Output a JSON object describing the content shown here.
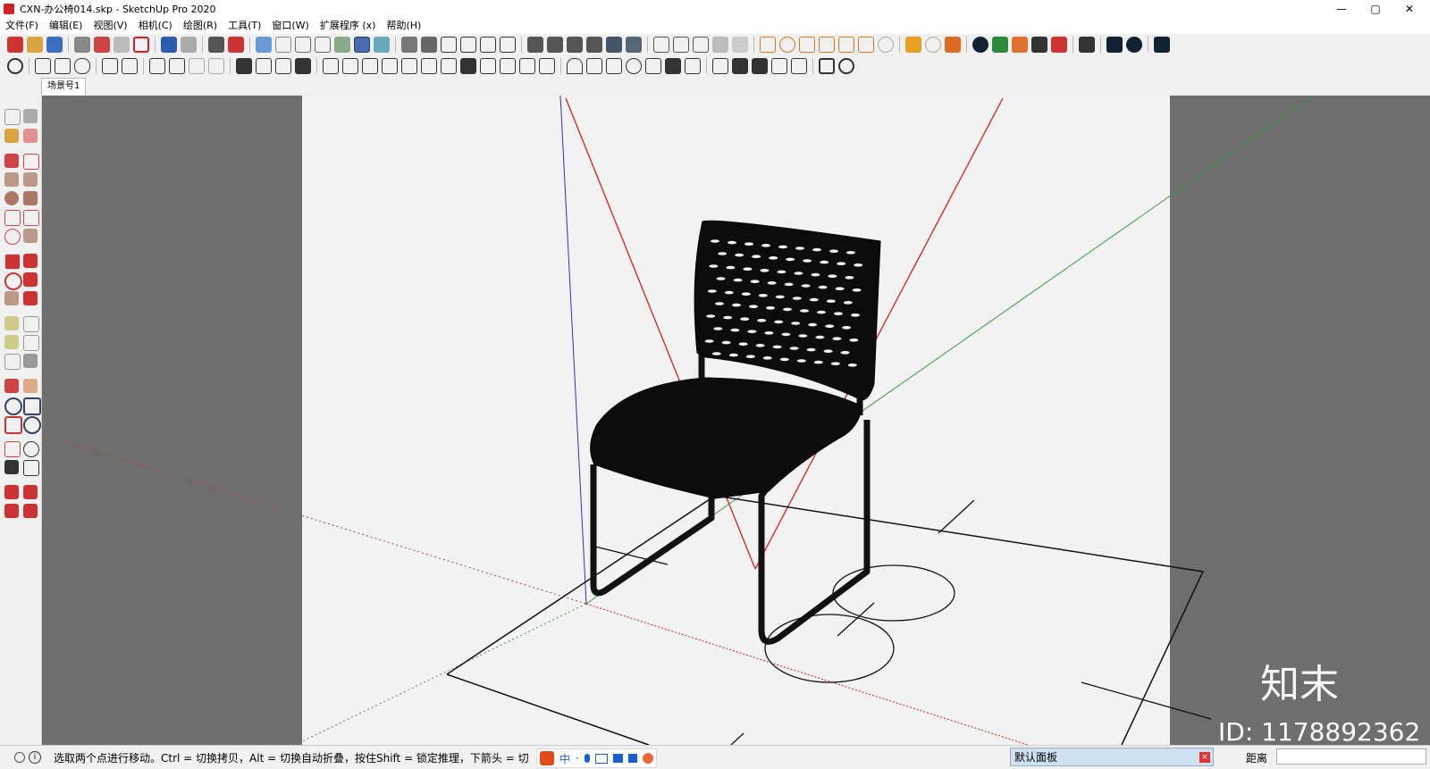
{
  "window": {
    "title": "CXN-办公椅014.skp - SketchUp Pro 2020",
    "controls": {
      "minimize": "—",
      "maximize": "▢",
      "close": "✕"
    }
  },
  "menu": [
    "文件(F)",
    "编辑(E)",
    "视图(V)",
    "相机(C)",
    "绘图(R)",
    "工具(T)",
    "窗口(W)",
    "扩展程序 (x)",
    "帮助(H)"
  ],
  "scene_tab": "场景号1",
  "status": {
    "message": "选取两个点进行移动。Ctrl = 切换拷贝，Alt = 切换自动折叠，按住Shift = 锁定推理，下箭头 = 切",
    "ime_label": "中",
    "panel_tray": "默认面板",
    "panel_close": "×",
    "vcb_label": "距离",
    "vcb_value": ""
  },
  "watermark": {
    "brand": "知末",
    "id": "ID: 1178892362"
  },
  "colors": {
    "axis_red": "#d42020",
    "axis_green": "#3a9a3a",
    "axis_blue": "#3030c0",
    "viewport_gray": "#6e6e6e",
    "canvas_bg": "#f2f2f2"
  },
  "icons": {
    "toolbar1": [
      "new-icon",
      "open-icon",
      "save-icon",
      "cut-icon",
      "copy-icon",
      "paste-icon",
      "erase-icon",
      "undo-icon",
      "redo-icon",
      "print-icon",
      "model-info-icon",
      "box-icon",
      "wire-icon",
      "hidden-icon",
      "shaded-icon",
      "textured-icon",
      "mono-icon",
      "iso-icon",
      "top-icon",
      "front-icon",
      "right-icon",
      "back-icon",
      "left-icon",
      "warehouse-icon",
      "component-icon",
      "extension-icon"
    ],
    "toolbar2": [
      "validate-icon",
      "bucket-icon",
      "cloud-icon",
      "layer-icon",
      "section-icon",
      "dimension-icon",
      "stairs-icon",
      "wall-icon",
      "fence-icon"
    ]
  }
}
